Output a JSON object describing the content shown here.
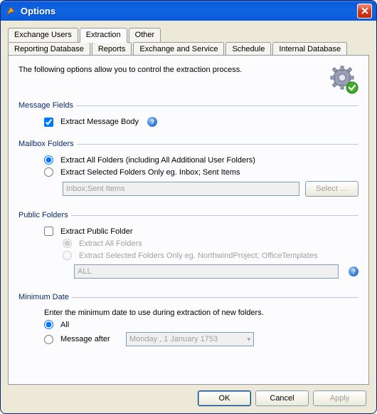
{
  "window": {
    "title": "Options"
  },
  "tabs": {
    "row1": [
      {
        "label": "Reporting Database"
      },
      {
        "label": "Reports"
      },
      {
        "label": "Exchange and Service"
      },
      {
        "label": "Schedule"
      },
      {
        "label": "Internal Database"
      }
    ],
    "row2": [
      {
        "label": "Exchange Users"
      },
      {
        "label": "Extraction"
      },
      {
        "label": "Other"
      }
    ],
    "active": "Extraction"
  },
  "intro": "The following options allow you to control the extraction process.",
  "groups": {
    "message_fields": {
      "legend": "Message Fields",
      "extract_body_label": "Extract Message Body"
    },
    "mailbox_folders": {
      "legend": "Mailbox Folders",
      "all_label": "Extract All Folders (including All Additional User Folders)",
      "selected_label": "Extract Selected Folders Only  eg. Inbox; Sent Items",
      "input_value": "Inbox;Sent Items",
      "select_btn": "Select …"
    },
    "public_folders": {
      "legend": "Public Folders",
      "extract_label": "Extract Public Folder",
      "all_label": "Extract All Folders",
      "selected_label": "Extract Selected Folders Only eg. NorthwindProject; OfficeTemplates",
      "input_value": "ALL"
    },
    "minimum_date": {
      "legend": "Minimum Date",
      "hint": "Enter the minimum date to use during extraction of new folders.",
      "all_label": "All",
      "after_label": "Message after",
      "date_value": "Monday , 1 January  1753"
    }
  },
  "buttons": {
    "ok": "OK",
    "cancel": "Cancel",
    "apply": "Apply"
  }
}
